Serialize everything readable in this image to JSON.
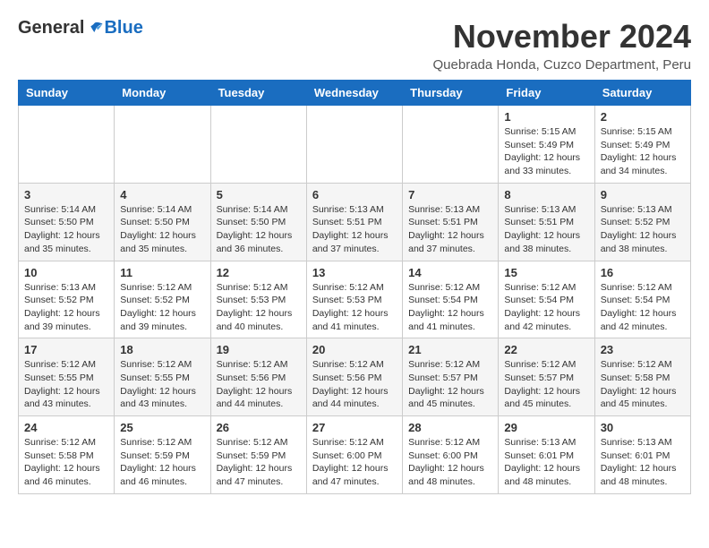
{
  "header": {
    "logo_general": "General",
    "logo_blue": "Blue",
    "month_title": "November 2024",
    "subtitle": "Quebrada Honda, Cuzco Department, Peru"
  },
  "weekdays": [
    "Sunday",
    "Monday",
    "Tuesday",
    "Wednesday",
    "Thursday",
    "Friday",
    "Saturday"
  ],
  "weeks": [
    [
      {
        "day": "",
        "info": ""
      },
      {
        "day": "",
        "info": ""
      },
      {
        "day": "",
        "info": ""
      },
      {
        "day": "",
        "info": ""
      },
      {
        "day": "",
        "info": ""
      },
      {
        "day": "1",
        "info": "Sunrise: 5:15 AM\nSunset: 5:49 PM\nDaylight: 12 hours\nand 33 minutes."
      },
      {
        "day": "2",
        "info": "Sunrise: 5:15 AM\nSunset: 5:49 PM\nDaylight: 12 hours\nand 34 minutes."
      }
    ],
    [
      {
        "day": "3",
        "info": "Sunrise: 5:14 AM\nSunset: 5:50 PM\nDaylight: 12 hours\nand 35 minutes."
      },
      {
        "day": "4",
        "info": "Sunrise: 5:14 AM\nSunset: 5:50 PM\nDaylight: 12 hours\nand 35 minutes."
      },
      {
        "day": "5",
        "info": "Sunrise: 5:14 AM\nSunset: 5:50 PM\nDaylight: 12 hours\nand 36 minutes."
      },
      {
        "day": "6",
        "info": "Sunrise: 5:13 AM\nSunset: 5:51 PM\nDaylight: 12 hours\nand 37 minutes."
      },
      {
        "day": "7",
        "info": "Sunrise: 5:13 AM\nSunset: 5:51 PM\nDaylight: 12 hours\nand 37 minutes."
      },
      {
        "day": "8",
        "info": "Sunrise: 5:13 AM\nSunset: 5:51 PM\nDaylight: 12 hours\nand 38 minutes."
      },
      {
        "day": "9",
        "info": "Sunrise: 5:13 AM\nSunset: 5:52 PM\nDaylight: 12 hours\nand 38 minutes."
      }
    ],
    [
      {
        "day": "10",
        "info": "Sunrise: 5:13 AM\nSunset: 5:52 PM\nDaylight: 12 hours\nand 39 minutes."
      },
      {
        "day": "11",
        "info": "Sunrise: 5:12 AM\nSunset: 5:52 PM\nDaylight: 12 hours\nand 39 minutes."
      },
      {
        "day": "12",
        "info": "Sunrise: 5:12 AM\nSunset: 5:53 PM\nDaylight: 12 hours\nand 40 minutes."
      },
      {
        "day": "13",
        "info": "Sunrise: 5:12 AM\nSunset: 5:53 PM\nDaylight: 12 hours\nand 41 minutes."
      },
      {
        "day": "14",
        "info": "Sunrise: 5:12 AM\nSunset: 5:54 PM\nDaylight: 12 hours\nand 41 minutes."
      },
      {
        "day": "15",
        "info": "Sunrise: 5:12 AM\nSunset: 5:54 PM\nDaylight: 12 hours\nand 42 minutes."
      },
      {
        "day": "16",
        "info": "Sunrise: 5:12 AM\nSunset: 5:54 PM\nDaylight: 12 hours\nand 42 minutes."
      }
    ],
    [
      {
        "day": "17",
        "info": "Sunrise: 5:12 AM\nSunset: 5:55 PM\nDaylight: 12 hours\nand 43 minutes."
      },
      {
        "day": "18",
        "info": "Sunrise: 5:12 AM\nSunset: 5:55 PM\nDaylight: 12 hours\nand 43 minutes."
      },
      {
        "day": "19",
        "info": "Sunrise: 5:12 AM\nSunset: 5:56 PM\nDaylight: 12 hours\nand 44 minutes."
      },
      {
        "day": "20",
        "info": "Sunrise: 5:12 AM\nSunset: 5:56 PM\nDaylight: 12 hours\nand 44 minutes."
      },
      {
        "day": "21",
        "info": "Sunrise: 5:12 AM\nSunset: 5:57 PM\nDaylight: 12 hours\nand 45 minutes."
      },
      {
        "day": "22",
        "info": "Sunrise: 5:12 AM\nSunset: 5:57 PM\nDaylight: 12 hours\nand 45 minutes."
      },
      {
        "day": "23",
        "info": "Sunrise: 5:12 AM\nSunset: 5:58 PM\nDaylight: 12 hours\nand 45 minutes."
      }
    ],
    [
      {
        "day": "24",
        "info": "Sunrise: 5:12 AM\nSunset: 5:58 PM\nDaylight: 12 hours\nand 46 minutes."
      },
      {
        "day": "25",
        "info": "Sunrise: 5:12 AM\nSunset: 5:59 PM\nDaylight: 12 hours\nand 46 minutes."
      },
      {
        "day": "26",
        "info": "Sunrise: 5:12 AM\nSunset: 5:59 PM\nDaylight: 12 hours\nand 47 minutes."
      },
      {
        "day": "27",
        "info": "Sunrise: 5:12 AM\nSunset: 6:00 PM\nDaylight: 12 hours\nand 47 minutes."
      },
      {
        "day": "28",
        "info": "Sunrise: 5:12 AM\nSunset: 6:00 PM\nDaylight: 12 hours\nand 48 minutes."
      },
      {
        "day": "29",
        "info": "Sunrise: 5:13 AM\nSunset: 6:01 PM\nDaylight: 12 hours\nand 48 minutes."
      },
      {
        "day": "30",
        "info": "Sunrise: 5:13 AM\nSunset: 6:01 PM\nDaylight: 12 hours\nand 48 minutes."
      }
    ]
  ]
}
